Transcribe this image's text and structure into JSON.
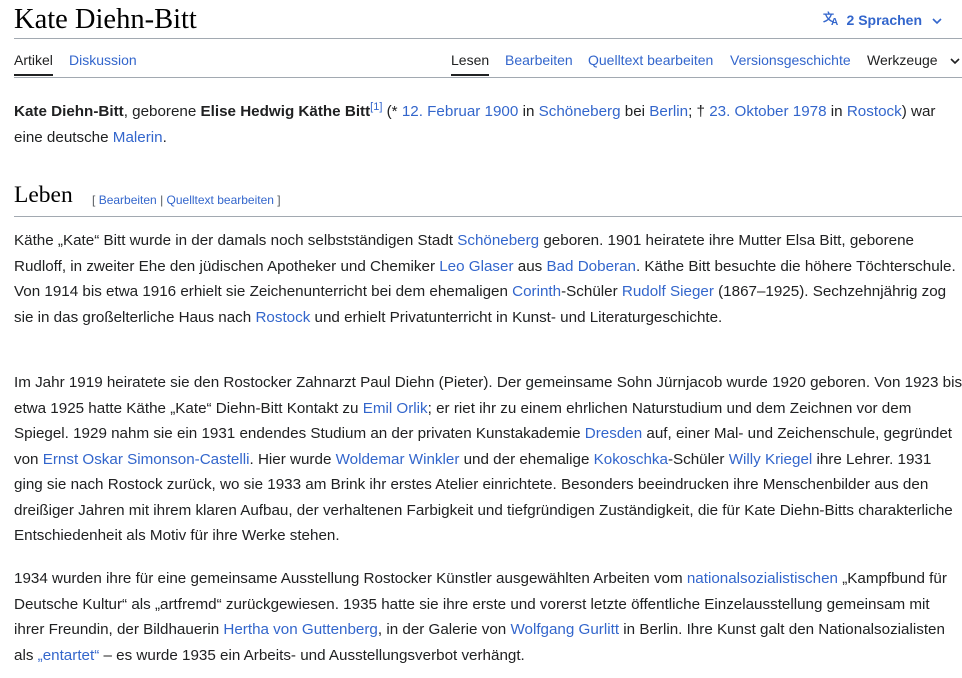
{
  "title": "Kate Diehn-Bitt",
  "languages_label": "2 Sprachen",
  "tabs": {
    "artikel": "Artikel",
    "diskussion": "Diskussion",
    "lesen": "Lesen",
    "bearbeiten": "Bearbeiten",
    "quelltext": "Quelltext bearbeiten",
    "versionen": "Versionsgeschichte",
    "werkzeuge": "Werkzeuge"
  },
  "lead": [
    {
      "t": "b",
      "v": "Kate Diehn-Bitt"
    },
    {
      "t": "s",
      "v": ", geborene "
    },
    {
      "t": "b",
      "v": "Elise Hedwig Käthe Bitt"
    },
    {
      "t": "sup",
      "v": "[1]"
    },
    {
      "t": "s",
      "v": " (* "
    },
    {
      "t": "a",
      "v": "12. Februar 1900"
    },
    {
      "t": "s",
      "v": " in "
    },
    {
      "t": "a",
      "v": "Schöneberg"
    },
    {
      "t": "s",
      "v": " bei "
    },
    {
      "t": "a",
      "v": "Berlin"
    },
    {
      "t": "s",
      "v": "; † "
    },
    {
      "t": "a",
      "v": "23. Oktober 1978"
    },
    {
      "t": "s",
      "v": " in "
    },
    {
      "t": "a",
      "v": "Rostock"
    },
    {
      "t": "s",
      "v": ") war eine deutsche "
    },
    {
      "t": "a",
      "v": "Malerin"
    },
    {
      "t": "s",
      "v": "."
    }
  ],
  "section": {
    "heading": "Leben",
    "open_bracket": "[",
    "edit": "Bearbeiten",
    "separator": " | ",
    "source_edit": "Quelltext bearbeiten",
    "close_bracket": "]"
  },
  "paragraphs": [
    [
      {
        "t": "s",
        "v": "Käthe „Kate“ Bitt wurde in der damals noch selbstständigen Stadt "
      },
      {
        "t": "a",
        "v": "Schöneberg"
      },
      {
        "t": "s",
        "v": " geboren. 1901 heiratete ihre Mutter Elsa Bitt, geborene Rudloff, in zweiter Ehe den jüdischen Apotheker und Chemiker "
      },
      {
        "t": "a",
        "v": "Leo Glaser"
      },
      {
        "t": "s",
        "v": " aus "
      },
      {
        "t": "a",
        "v": "Bad Doberan"
      },
      {
        "t": "s",
        "v": ". Käthe Bitt besuchte die höhere Töchterschule. Von 1914 bis etwa 1916 erhielt sie Zeichenunterricht bei dem ehemaligen "
      },
      {
        "t": "a",
        "v": "Corinth"
      },
      {
        "t": "s",
        "v": "-Schüler "
      },
      {
        "t": "a",
        "v": "Rudolf Sieger"
      },
      {
        "t": "s",
        "v": " (1867–1925). Sechzehnjährig zog sie in das großelterliche Haus nach "
      },
      {
        "t": "a",
        "v": "Rostock"
      },
      {
        "t": "s",
        "v": " und erhielt Privatunterricht in Kunst- und Literaturgeschichte."
      }
    ],
    [
      {
        "t": "s",
        "v": "Im Jahr 1919 heiratete sie den Rostocker Zahnarzt Paul Diehn (Pieter). Der gemeinsame Sohn Jürnjacob wurde 1920 geboren. Von 1923 bis etwa 1925 hatte Käthe „Kate“ Diehn-Bitt Kontakt zu "
      },
      {
        "t": "a",
        "v": "Emil Orlik"
      },
      {
        "t": "s",
        "v": "; er riet ihr zu einem ehrlichen Naturstudium und dem Zeichnen vor dem Spiegel. 1929 nahm sie ein 1931 endendes Studium an der privaten Kunstakademie "
      },
      {
        "t": "a",
        "v": "Dresden"
      },
      {
        "t": "s",
        "v": " auf, einer Mal- und Zeichenschule, gegründet von "
      },
      {
        "t": "a",
        "v": "Ernst Oskar Simonson-Castelli"
      },
      {
        "t": "s",
        "v": ". Hier wurde "
      },
      {
        "t": "a",
        "v": "Woldemar Winkler"
      },
      {
        "t": "s",
        "v": " und der ehemalige "
      },
      {
        "t": "a",
        "v": "Kokoschka"
      },
      {
        "t": "s",
        "v": "-Schüler "
      },
      {
        "t": "a",
        "v": "Willy Kriegel"
      },
      {
        "t": "s",
        "v": " ihre Lehrer. 1931 ging sie nach Rostock zurück, wo sie 1933 am Brink ihr erstes Atelier einrichtete. Besonders beeindrucken ihre Menschenbilder aus den dreißiger Jahren mit ihrem klaren Aufbau, der verhaltenen Farbigkeit und tiefgründigen Zuständigkeit, die für Kate Diehn-Bitts charakterliche Entschiedenheit als Motiv für ihre Werke stehen."
      }
    ],
    [
      {
        "t": "s",
        "v": "1934 wurden ihre für eine gemeinsame Ausstellung Rostocker Künstler ausgewählten Arbeiten vom "
      },
      {
        "t": "a",
        "v": "nationalsozialistischen"
      },
      {
        "t": "s",
        "v": " „Kampfbund für Deutsche Kultur“ als „artfremd“ zurückgewiesen. 1935 hatte sie ihre erste und vorerst letzte öffentliche Einzelausstellung gemeinsam mit ihrer Freundin, der Bildhauerin "
      },
      {
        "t": "a",
        "v": "Hertha von Guttenberg"
      },
      {
        "t": "s",
        "v": ", in der Galerie von "
      },
      {
        "t": "a",
        "v": "Wolfgang Gurlitt"
      },
      {
        "t": "s",
        "v": " in Berlin. Ihre Kunst galt den Nationalsozialisten als "
      },
      {
        "t": "a",
        "v": "„entartet“"
      },
      {
        "t": "s",
        "v": " – es wurde 1935 ein Arbeits- und Ausstellungsverbot verhängt."
      }
    ]
  ]
}
